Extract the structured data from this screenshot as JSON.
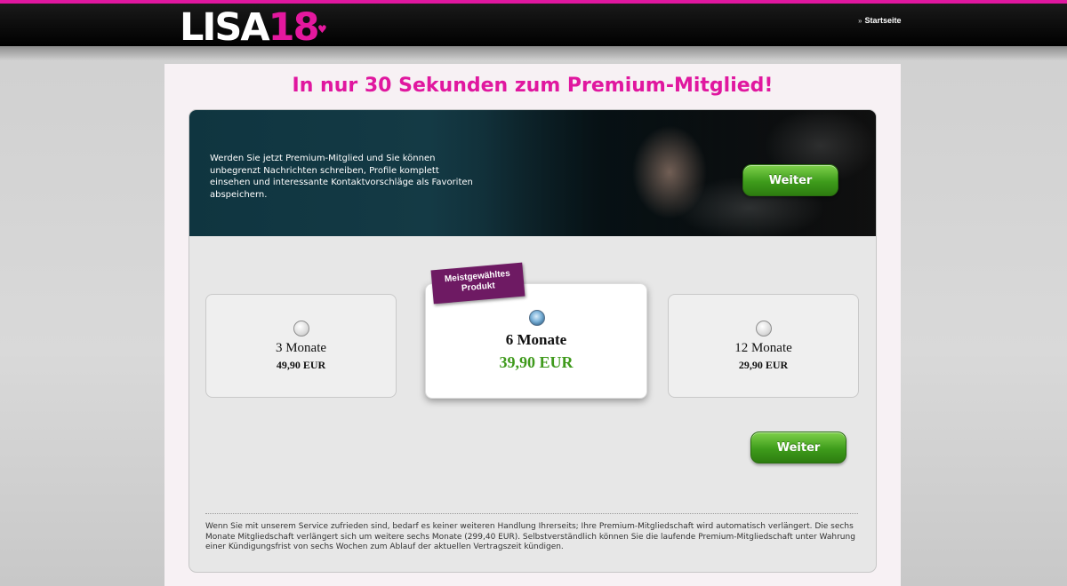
{
  "header": {
    "logo_white": "LISA",
    "logo_pink": "18",
    "nav_link": "Startseite"
  },
  "headline": "In nur 30 Sekunden zum Premium-Mitglied!",
  "banner": {
    "text": "Werden Sie jetzt Premium-Mitglied und Sie können unbegrenzt Nachrichten schreiben, Profile komplett einsehen und interessante Kontaktvorschläge als Favoriten abspeichern.",
    "button_label": "Weiter"
  },
  "ribbon": {
    "line1": "Meistgewähltes",
    "line2": "Produkt"
  },
  "plans": [
    {
      "duration": "3 Monate",
      "price": "49,90 EUR",
      "selected": false
    },
    {
      "duration": "6 Monate",
      "price": "39,90 EUR",
      "selected": true
    },
    {
      "duration": "12 Monate",
      "price": "29,90 EUR",
      "selected": false
    }
  ],
  "continue_button": "Weiter",
  "footnote": "Wenn Sie mit unserem Service zufrieden sind, bedarf es keiner weiteren Handlung Ihrerseits; Ihre Premium-Mitgliedschaft wird automatisch verlängert. Die sechs Monate Mitgliedschaft verlängert sich um weitere sechs Monate (299,40 EUR). Selbstverständlich können Sie die laufende Premium-Mitgliedschaft unter Wahrung einer Kündigungsfrist von sechs Wochen zum Ablauf der aktuellen Vertragszeit kündigen.",
  "colors": {
    "brand_pink": "#e0179f",
    "button_green": "#3e9c1b",
    "ribbon_purple": "#6e1a63"
  }
}
